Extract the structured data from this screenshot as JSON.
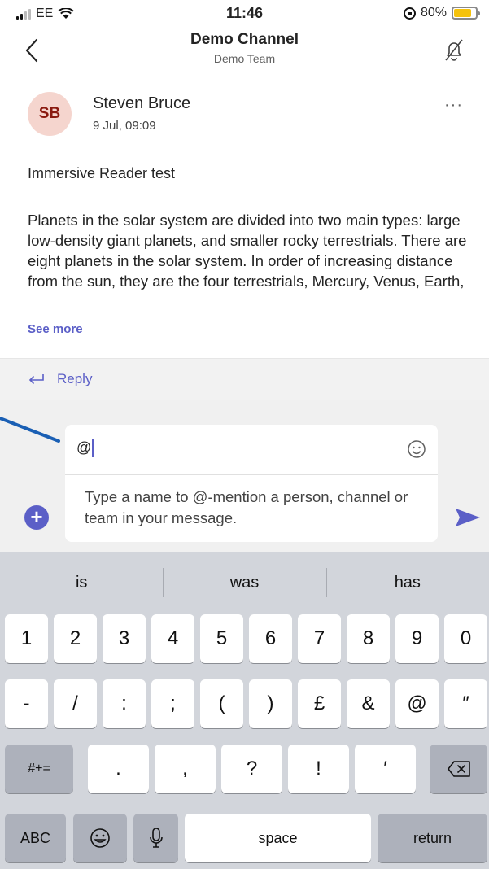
{
  "status_bar": {
    "carrier": "EE",
    "time": "11:46",
    "battery": "80%",
    "battery_level": 0.8,
    "colors": {
      "battery_fill": "#f5c20b"
    }
  },
  "header": {
    "title": "Demo Channel",
    "subtitle": "Demo Team",
    "back_icon": "chevron-left-icon",
    "notify_icon": "bell-off-icon"
  },
  "message": {
    "avatar_initials": "SB",
    "author": "Steven Bruce",
    "timestamp": "9 Jul, 09:09",
    "more": "···",
    "subject": "Immersive Reader test",
    "body": "Planets in the solar system are divided into two main types: large low-density giant planets, and smaller rocky terrestrials. There are eight planets in the solar system. In order of increasing distance from the sun, they are the four terrestrials, Mercury, Venus, Earth,",
    "see_more": "See more",
    "colors": {
      "avatar_bg": "#f5d5ce",
      "avatar_text": "#8a1a10",
      "accent": "#5b5fc7"
    }
  },
  "reply": {
    "label": "Reply"
  },
  "compose": {
    "value": "@",
    "mention_hint": "Type a name to @-mention a person, channel or team in your message.",
    "add_label": "+",
    "emoji_icon": "smiley-icon",
    "send_icon": "send-icon"
  },
  "keyboard": {
    "suggestions": [
      "is",
      "was",
      "has"
    ],
    "row1": [
      "1",
      "2",
      "3",
      "4",
      "5",
      "6",
      "7",
      "8",
      "9",
      "0"
    ],
    "row2": [
      "-",
      "/",
      ":",
      ";",
      "(",
      ")",
      "£",
      "&",
      "@",
      "″"
    ],
    "row3_left": "#+=",
    "row3": [
      ".",
      ",",
      "?",
      "!",
      "′"
    ],
    "row3_right_icon": "backspace-icon",
    "row4_abc": "ABC",
    "row4_emoji_icon": "emoji-icon",
    "row4_mic_icon": "microphone-icon",
    "space": "space",
    "return": "return"
  }
}
